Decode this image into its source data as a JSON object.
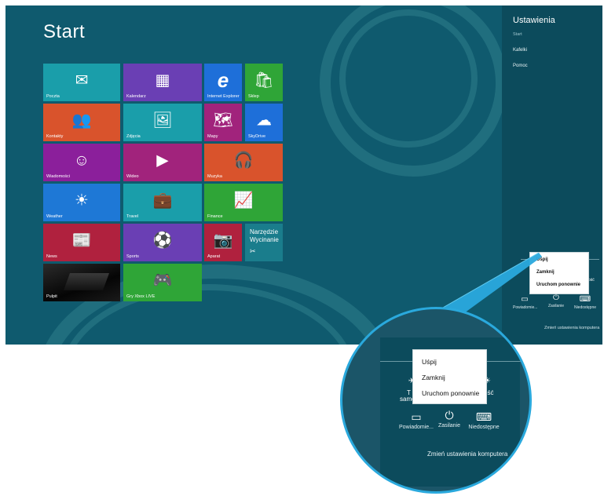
{
  "start": {
    "title": "Start",
    "tiles": [
      {
        "label": "Poczta",
        "icon": "✉",
        "color": "#1a9eaa"
      },
      {
        "label": "Kalendarz",
        "icon": "▦",
        "color": "#6a3fb4"
      },
      {
        "label": "Internet Explorer",
        "icon": "e",
        "color": "#1e6fd9"
      },
      {
        "label": "Sklep",
        "icon": "🛍",
        "color": "#2fa537"
      },
      {
        "label": "Kontakty",
        "icon": "👥",
        "color": "#d9532c"
      },
      {
        "label": "Zdjęcia",
        "icon": "🖼",
        "color": "#1a9eaa"
      },
      {
        "label": "Mapy",
        "icon": "🗺",
        "color": "#a1237c"
      },
      {
        "label": "SkyDrive",
        "icon": "☁",
        "color": "#1e6fd9"
      },
      {
        "label": "Wiadomości",
        "icon": "☺",
        "color": "#8b1f9b"
      },
      {
        "label": "Wideo",
        "icon": "▶",
        "color": "#a1237c"
      },
      {
        "label": "Muzyka",
        "icon": "🎧",
        "color": "#d9532c"
      },
      {
        "label": "Weather",
        "icon": "☀",
        "color": "#1e78d6"
      },
      {
        "label": "Travel",
        "icon": "💼",
        "color": "#1a9eaa"
      },
      {
        "label": "Finance",
        "icon": "📈",
        "color": "#2fa537"
      },
      {
        "label": "News",
        "icon": "📰",
        "color": "#b0213e"
      },
      {
        "label": "Sports",
        "icon": "⚽",
        "color": "#6a3fb4"
      },
      {
        "label": "Aparat",
        "icon": "📷",
        "color": "#b0213e"
      },
      {
        "label": "Narzędzie Wycinanie",
        "icon": "✂",
        "color": "#1a7d8c"
      },
      {
        "label": "Pulpit",
        "icon": "",
        "color": "#0b0b0b"
      },
      {
        "label": "Gry Xbox LIVE",
        "icon": "🎮",
        "color": "#2fa537"
      }
    ]
  },
  "settings": {
    "title": "Ustawienia",
    "subtitle": "Start",
    "links": [
      "Kafelki",
      "Pomoc"
    ],
    "power_menu": [
      "Uśpij",
      "Zamknij",
      "Uruchom ponownie"
    ],
    "system_icons": [
      {
        "label": "Powiadomie...",
        "icon": "▭"
      },
      {
        "label": "Zasilanie",
        "icon": "⏻"
      },
      {
        "label": "Niedostępne",
        "icon": "⌨"
      }
    ],
    "change_pc_settings": "Zmień ustawienia komputera",
    "fragments": {
      "brightness_left": "T",
      "brightness_left_2": "samo",
      "right": "ość"
    }
  },
  "colors": {
    "background": "#0f5a6e",
    "charm": "#0c4b5c",
    "callout": "#2aa9dd"
  }
}
